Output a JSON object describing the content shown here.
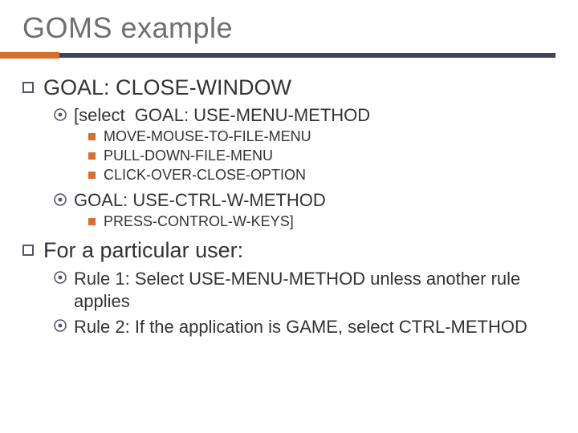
{
  "title": "GOMS example",
  "l1_goal": "GOAL: CLOSE-WINDOW",
  "l2_select": "[select  GOAL: USE-MENU-METHOD",
  "l3_a": "MOVE-MOUSE-TO-FILE-MENU",
  "l3_b": "PULL-DOWN-FILE-MENU",
  "l3_c": "CLICK-OVER-CLOSE-OPTION",
  "l2_goal2": "GOAL: USE-CTRL-W-METHOD",
  "l3_d": "PRESS-CONTROL-W-KEYS]",
  "l1_user": "For a particular user:",
  "rule1": "Rule 1: Select USE-MENU-METHOD unless another rule applies",
  "rule2": "Rule 2: If the application is GAME, select CTRL-METHOD"
}
